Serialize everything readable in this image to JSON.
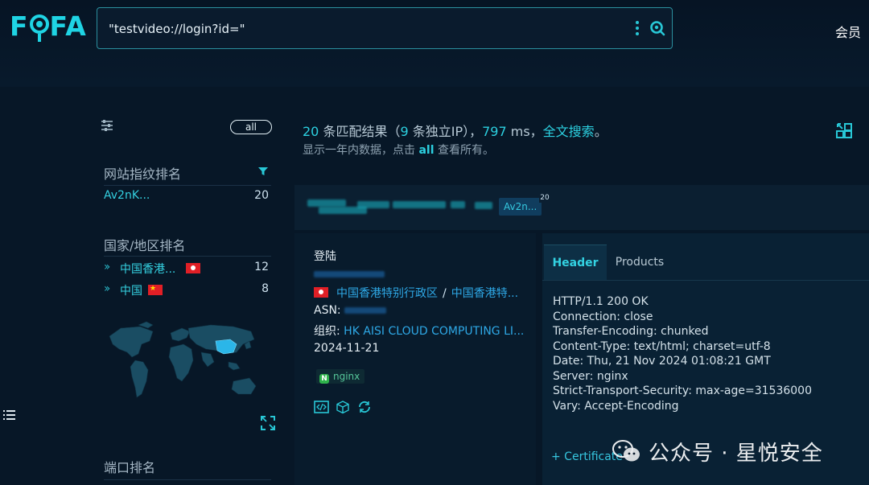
{
  "app": {
    "logo": "FOFA",
    "member_label": "会员"
  },
  "search": {
    "query": "\"testvideo://login?id=\""
  },
  "colors": {
    "background": "#071727",
    "accent": "#2cd0e0",
    "link": "#2ea8e6"
  },
  "icons": {
    "more": "more-vertical-icon",
    "search": "search-icon",
    "filter": "filter-sliders-icon",
    "funnel": "funnel-icon",
    "layout": "layout-grid-icon",
    "expand": "expand-icon",
    "menu": "list-menu-icon"
  },
  "sidebar": {
    "all_label": "all",
    "fingerprint_title": "网站指纹排名",
    "fingerprint_items": [
      {
        "label": "Av2nK...",
        "count": "20"
      }
    ],
    "country_title": "国家/地区排名",
    "country_items": [
      {
        "label": "中国香港...",
        "count": "12"
      },
      {
        "label": "中国",
        "count": "8"
      }
    ],
    "ports_title": "端口排名"
  },
  "summary": {
    "count": "20",
    "count_text": " 条匹配结果（",
    "ip_count": "9",
    "ip_text": " 条独立IP），",
    "ms": "797",
    "ms_text": " ms，",
    "full_search": "全文搜索",
    "period": "。",
    "sub_prefix": "显示一年内数据，点击 ",
    "sub_all": "all",
    "sub_suffix": " 查看所有。"
  },
  "result": {
    "tag": "Av2n...",
    "tag_badge": "20",
    "title": "登陆",
    "location_region": "中国香港特别行政区",
    "location_separator": "/",
    "location_city": "中国香港特...",
    "asn_label": "ASN:",
    "org_label": "组织:",
    "org_value": "HK AISI CLOUD COMPUTING LI...",
    "date": "2024-11-21",
    "server_tag": "nginx"
  },
  "detail": {
    "tabs": [
      "Header",
      "Products"
    ],
    "active_tab": "Header",
    "header_text": "HTTP/1.1 200 OK\nConnection: close\nTransfer-Encoding: chunked\nContent-Type: text/html; charset=utf-8\nDate: Thu, 21 Nov 2024 01:08:21 GMT\nServer: nginx\nStrict-Transport-Security: max-age=31536000\nVary: Accept-Encoding",
    "certificate_label": "+ Certificate"
  },
  "watermark": {
    "text": "公众号 · 星悦安全"
  }
}
